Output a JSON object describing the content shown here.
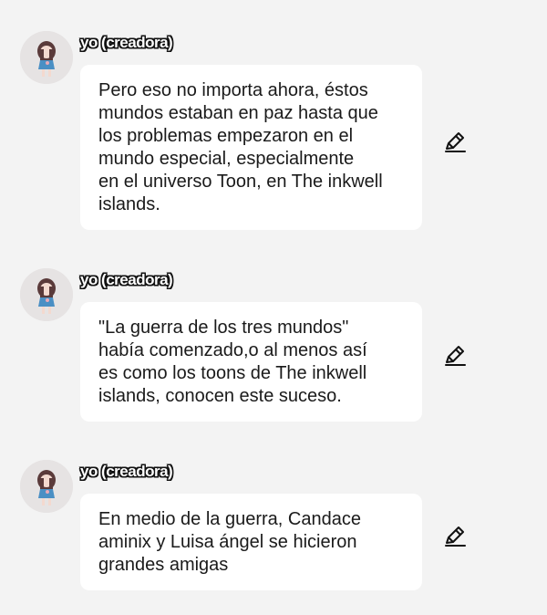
{
  "messages": [
    {
      "author": "yo (creadora)",
      "text": "Pero eso no importa ahora, éstos\nmundos estaban en paz hasta que\nlos problemas empezaron en el\nmundo especial, especialmente\nen el universo Toon, en The inkwell\nislands.",
      "avatar_icon": "girl-avatar-icon",
      "action_icon": "pencil-edit-icon"
    },
    {
      "author": "yo (creadora)",
      "text": "\"La guerra de los tres mundos\"\nhabía comenzado,o al menos así\nes como los toons de The inkwell\nislands, conocen este suceso.",
      "avatar_icon": "girl-avatar-icon",
      "action_icon": "pencil-edit-icon"
    },
    {
      "author": "yo (creadora)",
      "text": "En medio de la guerra, Candace\naminix y Luisa ángel se hicieron\ngrandes amigas",
      "avatar_icon": "girl-avatar-icon",
      "action_icon": "pencil-edit-icon"
    }
  ],
  "colors": {
    "background": "#f3f3f3",
    "bubble": "#ffffff",
    "text": "#1a1a1a"
  }
}
